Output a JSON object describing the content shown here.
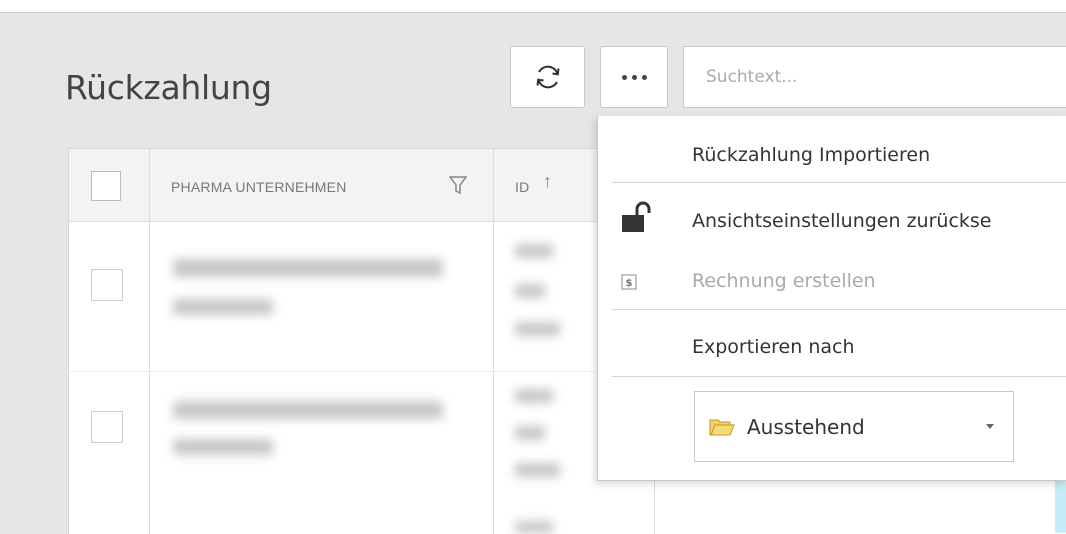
{
  "page": {
    "title": "Rückzahlung"
  },
  "toolbar": {
    "search_placeholder": "Suchtext..."
  },
  "table": {
    "columns": [
      {
        "label": "PHARMA UNTERNEHMEN"
      },
      {
        "label": "ID"
      }
    ]
  },
  "menu": {
    "items": [
      {
        "label": "Rückzahlung Importieren"
      },
      {
        "label": "Ansichtseinstellungen zurückse"
      },
      {
        "label": "Rechnung erstellen",
        "disabled": true
      },
      {
        "label": "Exportieren nach"
      }
    ],
    "status_filter": {
      "selected": "Ausstehend"
    }
  },
  "colors": {
    "menu_bg": "#ffffff",
    "disabled_text": "#aaaaaa",
    "folder_icon": "#f0c64c"
  }
}
